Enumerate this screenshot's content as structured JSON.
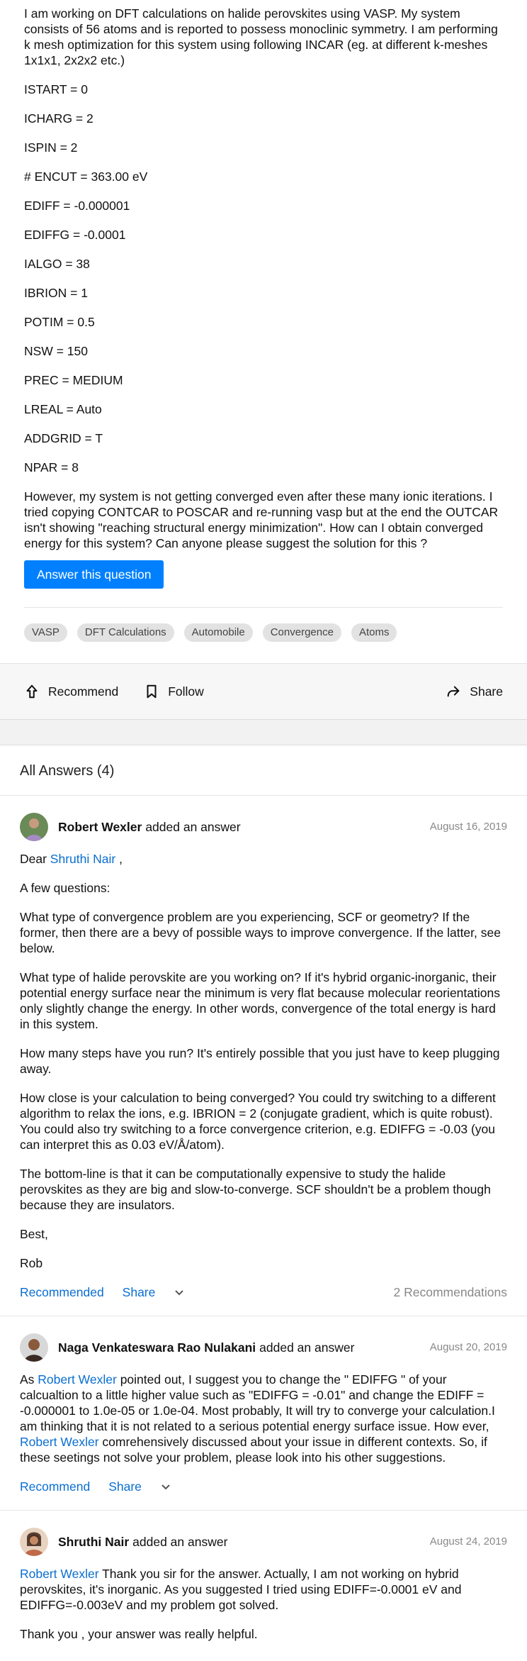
{
  "question": {
    "intro": "I am working on DFT calculations on halide perovskites using VASP. My system consists of 56 atoms and is reported to possess monoclinic symmetry. I am performing k mesh optimization for this system using following INCAR (eg. at different k-meshes 1x1x1, 2x2x2 etc.)",
    "params": [
      "ISTART = 0",
      "ICHARG = 2",
      "ISPIN = 2",
      "# ENCUT = 363.00 eV",
      "EDIFF = -0.000001",
      "EDIFFG = -0.0001",
      "IALGO = 38",
      "IBRION = 1",
      "POTIM = 0.5",
      "NSW = 150",
      "PREC = MEDIUM",
      "LREAL = Auto",
      "ADDGRID = T",
      "NPAR = 8"
    ],
    "closing": "However, my system is not getting converged even after these many ionic iterations. I tried copying CONTCAR to POSCAR and re-running vasp but at the end the OUTCAR isn't showing \"reaching structural energy minimization\". How can I obtain converged energy for this system? Can anyone please suggest the solution for this ?",
    "answer_button": "Answer this question",
    "tags": [
      "VASP",
      "DFT Calculations",
      "Automobile",
      "Convergence",
      "Atoms"
    ]
  },
  "actions": {
    "recommend": "Recommend",
    "follow": "Follow",
    "share": "Share"
  },
  "answers_header": "All Answers (4)",
  "answers": [
    {
      "author": "Robert Wexler",
      "added": "added an answer",
      "date": "August 16, 2019",
      "greeting_prefix": "Dear ",
      "greeting_link": "Shruthi Nair",
      "greeting_suffix": " ,",
      "paragraphs": [
        "A few questions:",
        "What type of convergence problem are you experiencing, SCF or geometry? If the former, then there are a bevy of possible ways to improve convergence. If the latter, see below.",
        "What type of halide perovskite are you working on? If it's hybrid organic-inorganic, their potential energy surface near the minimum is very flat because molecular reorientations only slightly change the energy. In other words, convergence of the total energy is hard in this system.",
        "How many steps have you run? It's entirely possible that you just have to keep plugging away.",
        "How close is your calculation to being converged? You could try switching to a different algorithm to relax the ions, e.g. IBRION = 2 (conjugate gradient, which is quite robust). You could also try switching to a force convergence criterion, e.g. EDIFFG = -0.03 (you can interpret this as 0.03 eV/Å/atom).",
        "The bottom-line is that it can be computationally expensive to study the halide perovskites as they are big and slow-to-converge. SCF shouldn't be a problem though because they are insulators.",
        "Best,",
        "Rob"
      ],
      "recommend_label": "Recommended",
      "share_label": "Share",
      "recommendations": "2 Recommendations"
    },
    {
      "author": "Naga Venkateswara Rao Nulakani",
      "added": "added an answer",
      "date": "August 20, 2019",
      "p_a": "As ",
      "link1": "Robert Wexler",
      "p_b": " pointed out, I suggest you to change the \" EDIFFG \" of your calcualtion to a little higher value such as \"EDIFFG = -0.01\" and change the EDIFF = -0.000001 to 1.0e-05 or 1.0e-04. Most probably, It will try to converge your calculation.I am thinking that it is not related to a serious potential energy surface issue. How ever, ",
      "link2": "Robert Wexler",
      "p_c": " comrehensively discussed about your issue in different contexts. So, if these seetings not solve your problem, please look into his other suggestions.",
      "recommend_label": "Recommend",
      "share_label": "Share"
    },
    {
      "author": "Shruthi Nair",
      "added": "added an answer",
      "date": "August 24, 2019",
      "link1": "Robert Wexler",
      "p_a": " Thank you sir for the answer. Actually, I am not working on hybrid perovskites, it's inorganic. As you suggested I tried using EDIFF=-0.0001 eV and EDIFFG=-0.003eV and my problem got solved.",
      "p_b": "Thank you , your answer was really helpful."
    }
  ],
  "icons": {
    "recommend": "arrow-up-icon",
    "follow": "bookmark-icon",
    "share": "share-arrow-icon",
    "more": "chevron-down-icon"
  },
  "colors": {
    "accent": "#0080ff",
    "link": "#0a6ed1",
    "meta": "#888888"
  }
}
